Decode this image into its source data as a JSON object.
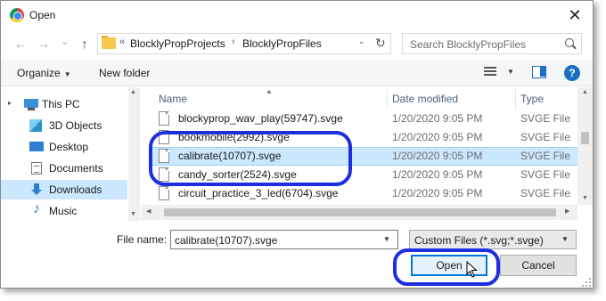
{
  "window": {
    "title": "Open",
    "close_glyph": "✕",
    "app_icon": "chrome-icon"
  },
  "nav_buttons": {
    "back": "←",
    "forward": "→",
    "recent": "⌄",
    "up": "↑"
  },
  "address": {
    "prefix": "«",
    "crumbs": [
      "BlocklyPropProjects",
      "BlocklyPropFiles"
    ],
    "separator": "›",
    "dropdown": "⌄",
    "refresh": "↻"
  },
  "search": {
    "placeholder": "Search BlocklyPropFiles"
  },
  "toolbar": {
    "organize": "Organize",
    "new_folder": "New folder",
    "help": "?"
  },
  "nav_pane": {
    "items": [
      {
        "label": "This PC",
        "icon": "computer-icon",
        "selected": false
      },
      {
        "label": "3D Objects",
        "icon": "3d-objects-icon",
        "selected": false
      },
      {
        "label": "Desktop",
        "icon": "desktop-icon",
        "selected": false
      },
      {
        "label": "Documents",
        "icon": "documents-icon",
        "selected": false
      },
      {
        "label": "Downloads",
        "icon": "downloads-icon",
        "selected": true
      },
      {
        "label": "Music",
        "icon": "music-icon",
        "selected": false
      }
    ]
  },
  "file_list": {
    "columns": {
      "name": "Name",
      "date": "Date modified",
      "type": "Type"
    },
    "rows": [
      {
        "name": "blockyprop_wav_play(59747).svge",
        "date": "1/20/2020 9:05 PM",
        "type": "SVGE File",
        "selected": false
      },
      {
        "name": "bookmobile(2992).svge",
        "date": "1/20/2020 9:05 PM",
        "type": "SVGE File",
        "selected": false
      },
      {
        "name": "calibrate(10707).svge",
        "date": "1/20/2020 9:05 PM",
        "type": "SVGE File",
        "selected": true
      },
      {
        "name": "candy_sorter(2524).svge",
        "date": "1/20/2020 9:05 PM",
        "type": "SVGE File",
        "selected": false
      },
      {
        "name": "circuit_practice_3_led(6704).svge",
        "date": "1/20/2020 9:05 PM",
        "type": "SVGE File",
        "selected": false
      }
    ]
  },
  "bottom": {
    "file_name_label": "File name:",
    "file_name_value": "calibrate(10707).svge",
    "filter": "Custom Files (*.svg;*.svge)",
    "open": "Open",
    "cancel": "Cancel"
  },
  "colors": {
    "highlight_oval": "#1d2ee0",
    "selection": "#cce8ff",
    "accent": "#0078d7"
  }
}
